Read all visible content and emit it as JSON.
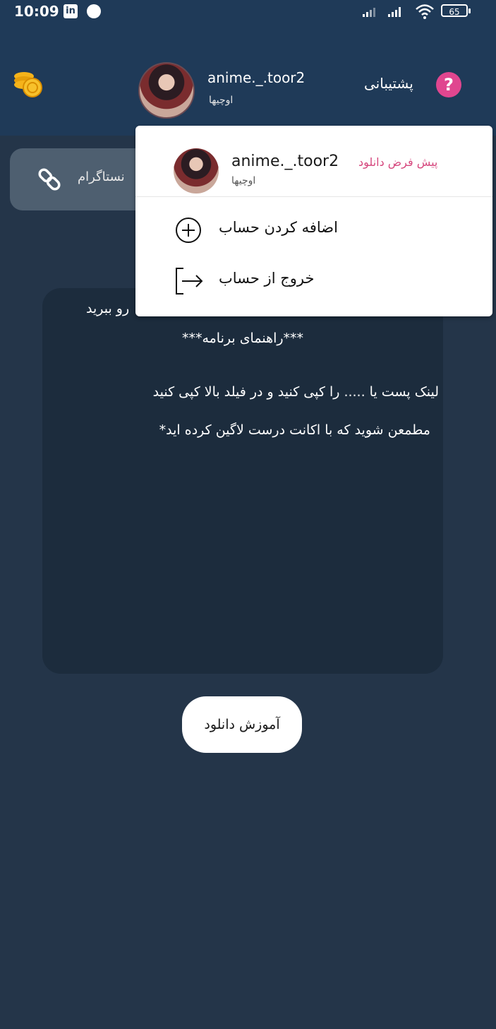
{
  "status_bar": {
    "time": "10:09",
    "battery": "65"
  },
  "header": {
    "username": "anime._.toor2",
    "subtitle": "اوچیها",
    "support_label": "پشتیبانی"
  },
  "link_field": {
    "placeholder": "نستاگرام"
  },
  "guide": {
    "line1": "رو ببرید",
    "line2": "***راهنمای برنامه***",
    "line3": "لینک پست یا ..... را کپی کنید و در فیلد بالا کپی کنید",
    "line4": "مطمعن شوید که با اکانت درست لاگین کرده اید*"
  },
  "tutorial_button": {
    "label": "آموزش دانلود"
  },
  "dropdown": {
    "account_username": "anime._.toor2",
    "account_subtitle": "اوچیها",
    "default_badge": "پیش فرض دانلود",
    "add_account_label": "اضافه کردن حساب",
    "logout_label": "خروج از حساب"
  },
  "colors": {
    "header_bg": "#1f3a58",
    "page_bg": "#243549",
    "card_bg": "#1c2c3d",
    "accent_pink": "#e0468f",
    "default_badge": "#d6487e"
  },
  "icons": [
    "coins-icon",
    "help-icon",
    "link-icon",
    "add-circle-icon",
    "logout-icon",
    "wifi-icon",
    "battery-icon"
  ]
}
